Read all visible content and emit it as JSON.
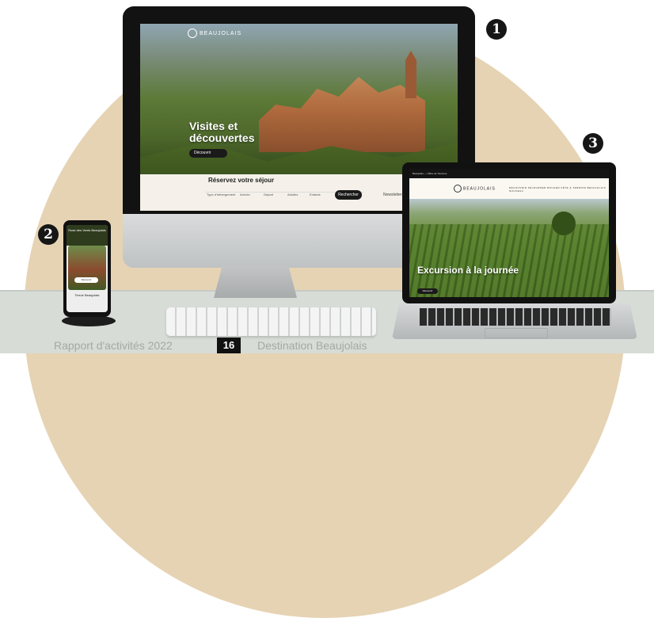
{
  "badges": [
    "1",
    "2",
    "3"
  ],
  "desktop_site": {
    "logo": "BEAUJOLAIS",
    "hero_title": "Visites et découvertes",
    "hero_button": "Découvrir",
    "booking_title": "Réservez votre séjour",
    "booking_fields": [
      "Type d'hébergement",
      "Arrivée",
      "Départ",
      "Adultes",
      "Enfants"
    ],
    "search_button": "Rechercher",
    "side_label": "Newsletter"
  },
  "phone_site": {
    "header": "Rose des Vents Beaujolais",
    "button": "Découvrir",
    "text": "Terroir Beaujolais"
  },
  "laptop_site": {
    "topbar": "Beaujolais — Office de Tourisme",
    "logo": "BEAUJOLAIS",
    "menu": "DÉCOUVRIR   SÉJOURNER   BOUGER   FÊTE & TERROIR   BEAUJOLAIS NOUVEAU",
    "hero_title": "Excursion à la journée",
    "hero_button": "Découvrir"
  },
  "footer": {
    "left": "Rapport d'activités 2022",
    "page_number": "16",
    "right": "Destination Beaujolais"
  }
}
